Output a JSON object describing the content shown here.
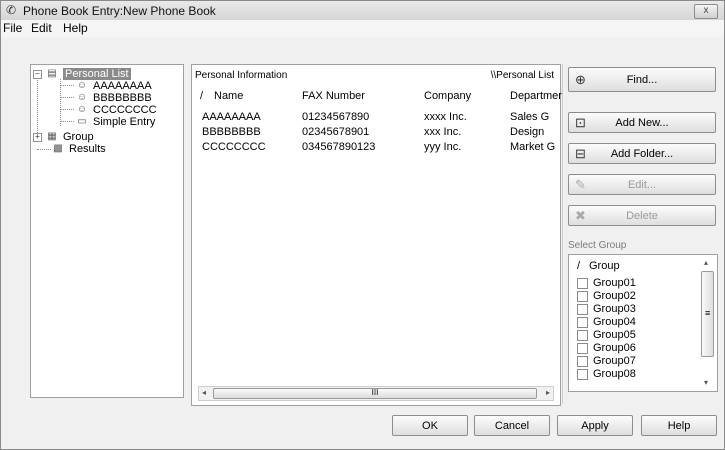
{
  "window": {
    "title": "Phone Book Entry:New Phone Book",
    "close_label": "x"
  },
  "menu": [
    "File",
    "Edit",
    "Help"
  ],
  "tree": {
    "root_label": "Personal List",
    "children": [
      "AAAAAAAA",
      "BBBBBBBB",
      "CCCCCCCC",
      "Simple Entry"
    ],
    "group_label": "Group",
    "results_label": "Results",
    "expanded_symbol": "−",
    "collapsed_symbol": "+"
  },
  "list": {
    "info_label": "Personal Information",
    "path_label": "\\\\Personal List",
    "columns": [
      "Name",
      "FAX Number",
      "Company",
      "Departmer"
    ],
    "sort_mark": "/",
    "rows": [
      [
        "AAAAAAAA",
        "01234567890",
        "xxxx Inc.",
        "Sales G"
      ],
      [
        "BBBBBBBB",
        "02345678901",
        "xxx Inc.",
        "Design"
      ],
      [
        "CCCCCCCC",
        "034567890123",
        "yyy Inc.",
        "Market G"
      ]
    ],
    "scroll_thumb_grip": "III",
    "scroll_left": "◂",
    "scroll_right": "▸"
  },
  "buttons": {
    "find": "Find...",
    "add_new": "Add New...",
    "add_folder": "Add Folder...",
    "edit": "Edit...",
    "delete": "Delete"
  },
  "select_group": {
    "label": "Select Group",
    "header": "Group",
    "sort_mark": "/",
    "items": [
      "Group01",
      "Group02",
      "Group03",
      "Group04",
      "Group05",
      "Group06",
      "Group07",
      "Group08"
    ],
    "scroll_up": "▴",
    "scroll_down": "▾",
    "thumb_grip": "≡"
  },
  "footer": {
    "ok": "OK",
    "cancel": "Cancel",
    "apply": "Apply",
    "help": "Help"
  },
  "icons": {
    "phonebook": "phonebook-icon",
    "person": "person-icon",
    "group": "group-icon",
    "results": "results-icon",
    "find": "binoculars-icon",
    "add_new": "add-entry-icon",
    "add_folder": "add-folder-icon",
    "edit": "edit-icon",
    "delete": "delete-icon"
  }
}
